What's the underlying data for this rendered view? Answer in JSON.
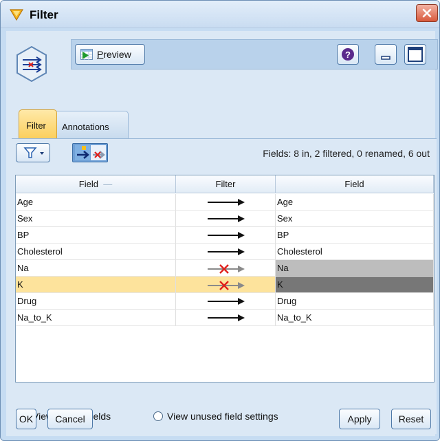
{
  "window": {
    "title": "Filter"
  },
  "toolbar": {
    "preview_label": "Preview"
  },
  "tabs": [
    {
      "label": "Filter"
    },
    {
      "label": "Annotations"
    }
  ],
  "summary": "Fields: 8 in, 2 filtered, 0 renamed, 6 out",
  "table": {
    "headers": {
      "field_in": "Field",
      "filter": "Filter",
      "field_out": "Field"
    },
    "rows": [
      {
        "in": "Age",
        "out": "Age",
        "filtered": false
      },
      {
        "in": "Sex",
        "out": "Sex",
        "filtered": false
      },
      {
        "in": "BP",
        "out": "BP",
        "filtered": false
      },
      {
        "in": "Cholesterol",
        "out": "Cholesterol",
        "filtered": false
      },
      {
        "in": "Na",
        "out": "Na",
        "filtered": true
      },
      {
        "in": "K",
        "out": "K",
        "filtered": true,
        "selected": true
      },
      {
        "in": "Drug",
        "out": "Drug",
        "filtered": false
      },
      {
        "in": "Na_to_K",
        "out": "Na_to_K",
        "filtered": false
      }
    ]
  },
  "options": {
    "view_current": "View current fields",
    "view_unused": "View unused field settings",
    "selected": "view_current"
  },
  "buttons": {
    "ok": "OK",
    "cancel": "Cancel",
    "apply": "Apply",
    "reset": "Reset"
  },
  "colors": {
    "selected_row": "#fde39c",
    "filtered_x": "#e0201b",
    "tab_active": "#fbcf5d"
  }
}
